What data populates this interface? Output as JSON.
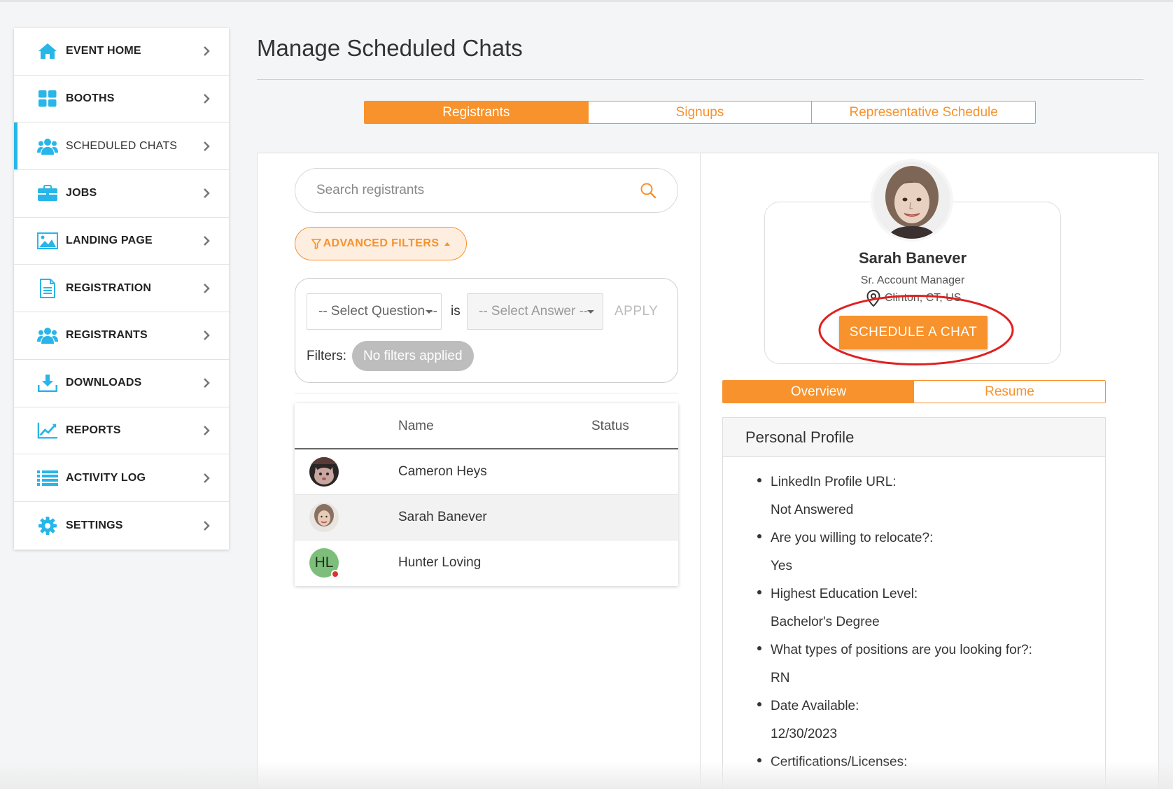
{
  "sidebar": {
    "items": [
      {
        "label": "EVENT HOME",
        "icon": "home-icon"
      },
      {
        "label": "BOOTHS",
        "icon": "grid-icon"
      },
      {
        "label": "SCHEDULED CHATS",
        "icon": "users-icon",
        "active": true
      },
      {
        "label": "JOBS",
        "icon": "briefcase-icon"
      },
      {
        "label": "LANDING PAGE",
        "icon": "image-icon"
      },
      {
        "label": "REGISTRATION",
        "icon": "document-icon"
      },
      {
        "label": "REGISTRANTS",
        "icon": "users-icon"
      },
      {
        "label": "DOWNLOADS",
        "icon": "download-icon"
      },
      {
        "label": "REPORTS",
        "icon": "chart-icon"
      },
      {
        "label": "ACTIVITY LOG",
        "icon": "list-icon"
      },
      {
        "label": "SETTINGS",
        "icon": "gear-icon"
      }
    ]
  },
  "header": {
    "title": "Manage Scheduled Chats"
  },
  "tabs": [
    {
      "label": "Registrants",
      "active": true
    },
    {
      "label": "Signups"
    },
    {
      "label": "Representative Schedule"
    }
  ],
  "search": {
    "placeholder": "Search registrants"
  },
  "filters": {
    "advanced_label": "ADVANCED FILTERS",
    "question_select": "-- Select Question --",
    "is_label": "is",
    "answer_select": "-- Select Answer --",
    "apply_label": "APPLY",
    "filters_label": "Filters:",
    "no_filters": "No filters applied"
  },
  "table": {
    "columns": [
      "Name",
      "Status"
    ],
    "rows": [
      {
        "name": "Cameron Heys",
        "avatar": "photo",
        "status": ""
      },
      {
        "name": "Sarah Banever",
        "avatar": "photo",
        "status": "",
        "selected": true
      },
      {
        "name": "Hunter Loving",
        "avatar": "initials",
        "initials": "HL",
        "status": ""
      }
    ]
  },
  "profile": {
    "name": "Sarah Banever",
    "role": "Sr. Account Manager",
    "location": "Clinton, CT, US",
    "schedule_button": "SCHEDULE A CHAT",
    "tabs": [
      {
        "label": "Overview",
        "active": true
      },
      {
        "label": "Resume"
      }
    ],
    "section_title": "Personal Profile",
    "fields": [
      {
        "q": "LinkedIn Profile URL:",
        "a": "Not Answered"
      },
      {
        "q": "Are you willing to relocate?:",
        "a": "Yes"
      },
      {
        "q": "Highest Education Level:",
        "a": "Bachelor's Degree"
      },
      {
        "q": "What types of positions are you looking for?:",
        "a": "RN"
      },
      {
        "q": "Date Available:",
        "a": "12/30/2023"
      },
      {
        "q": "Certifications/Licenses:",
        "a": ""
      }
    ]
  },
  "colors": {
    "accent": "#f7922c",
    "icon_blue": "#28b6e8",
    "annotation_red": "#e02020",
    "status_offline": "#e03030"
  }
}
